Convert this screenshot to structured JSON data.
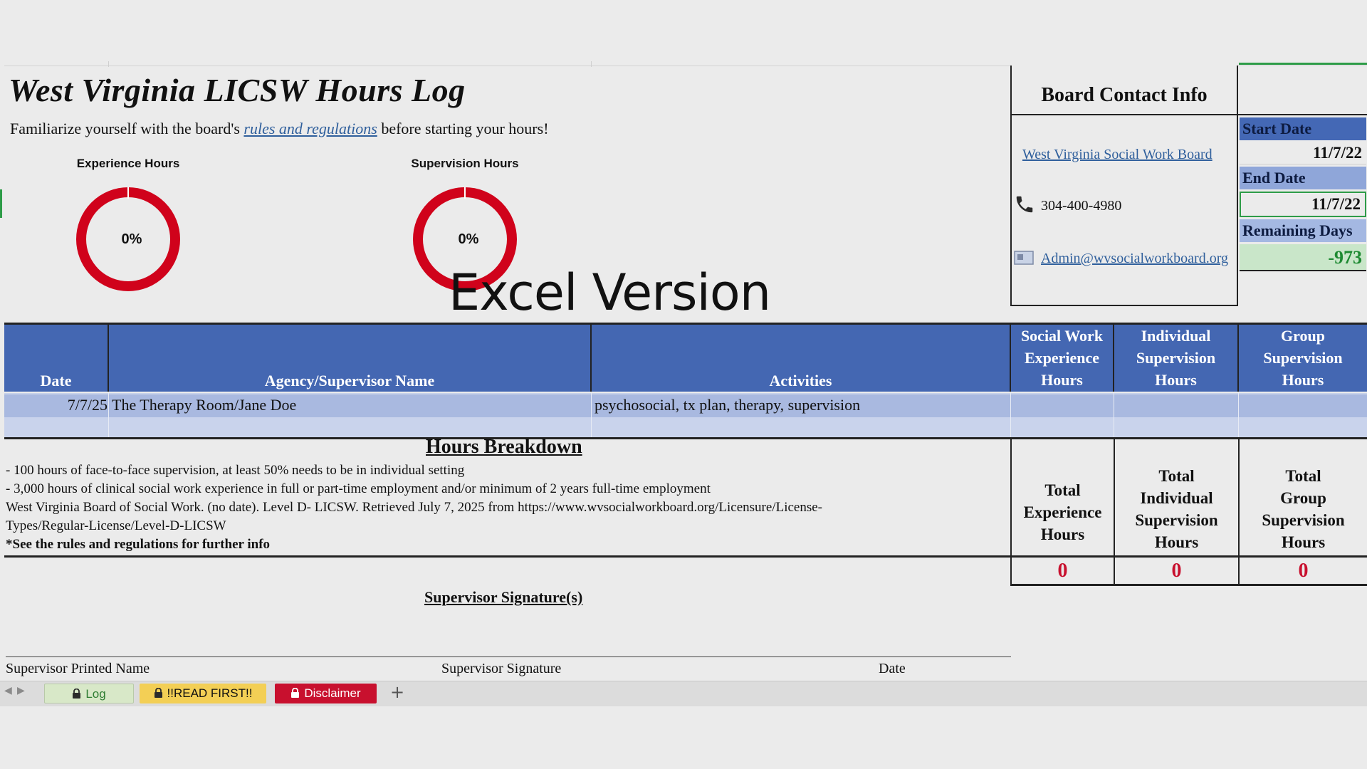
{
  "header": {
    "title": "West Virginia LICSW Hours Log",
    "intro_before": "Familiarize yourself with the board's ",
    "intro_link": "rules and regulations",
    "intro_after": " before starting your hours!"
  },
  "gauges": [
    {
      "label": "Experience Hours",
      "value": "0%",
      "fraction": 0,
      "color": "#d0021b"
    },
    {
      "label": "Supervision Hours",
      "value": "0%",
      "fraction": 0,
      "color": "#d0021b"
    }
  ],
  "overlay": {
    "text": "Excel Version"
  },
  "contact": {
    "heading": "Board Contact Info",
    "website": "West Virginia Social Work Board",
    "phone": "304-400-4980",
    "email": "Admin@wvsocialworkboard.org",
    "phone_icon": "phone-icon",
    "email_icon": "envelope-icon"
  },
  "dates": {
    "start_label": "Start Date",
    "start_value": "11/7/22",
    "end_label": "End Date",
    "end_value": "11/7/22",
    "remaining_label": "Remaining Days",
    "remaining_value": "-973",
    "remaining_color": "#1e8a32"
  },
  "table": {
    "columns": {
      "date": "Date",
      "agency": "Agency/Supervisor Name",
      "activities": "Activities",
      "sw_1": "Social Work",
      "sw_2": "Experience",
      "sw_3": "Hours",
      "ind_1": "Individual",
      "ind_2": "Supervision",
      "ind_3": "Hours",
      "grp_1": "Group",
      "grp_2": "Supervision",
      "grp_3": "Hours"
    },
    "rows": [
      {
        "date": "7/7/25",
        "agency": "The Therapy Room/Jane Doe",
        "activities": "psychosocial, tx plan, therapy, supervision",
        "sw": "",
        "ind": "",
        "grp": ""
      }
    ]
  },
  "breakdown": {
    "title": "Hours Breakdown",
    "lines": [
      "- 100 hours of face-to-face supervision, at least 50% needs to be in individual setting",
      "- 3,000 hours of clinical social work experience in full or part-time employment and/or minimum of 2 years full-time employment",
      "West Virginia Board of Social Work. (no date). Level D- LICSW. Retrieved July 7, 2025 from https://www.wvsocialworkboard.org/Licensure/License-",
      "Types/Regular-License/Level-D-LICSW",
      "*See the rules and regulations for further info"
    ]
  },
  "totals": {
    "exp_1": "Total",
    "exp_2": "Experience",
    "exp_3": "Hours",
    "ind_1": "Total",
    "ind_2": "Individual",
    "ind_3": "Supervision",
    "ind_4": "Hours",
    "grp_1": "Total",
    "grp_2": "Group",
    "grp_3": "Supervision",
    "grp_4": "Hours",
    "exp_value": "0",
    "ind_value": "0",
    "grp_value": "0"
  },
  "signature": {
    "title": "Supervisor Signature(s)",
    "printed_name": "Supervisor Printed Name",
    "signature": "Supervisor Signature",
    "date": "Date"
  },
  "tabs": [
    {
      "label": "Log",
      "color": "#d8e8c8",
      "text_color": "#2e7d32",
      "icon": "lock-icon"
    },
    {
      "label": "!!READ FIRST!!",
      "color": "#f3cf55",
      "text_color": "#111111",
      "icon": "lock-icon"
    },
    {
      "label": "Disclaimer",
      "color": "#c8102e",
      "text_color": "#ffffff",
      "icon": "lock-icon"
    }
  ],
  "add_sheet": "+"
}
